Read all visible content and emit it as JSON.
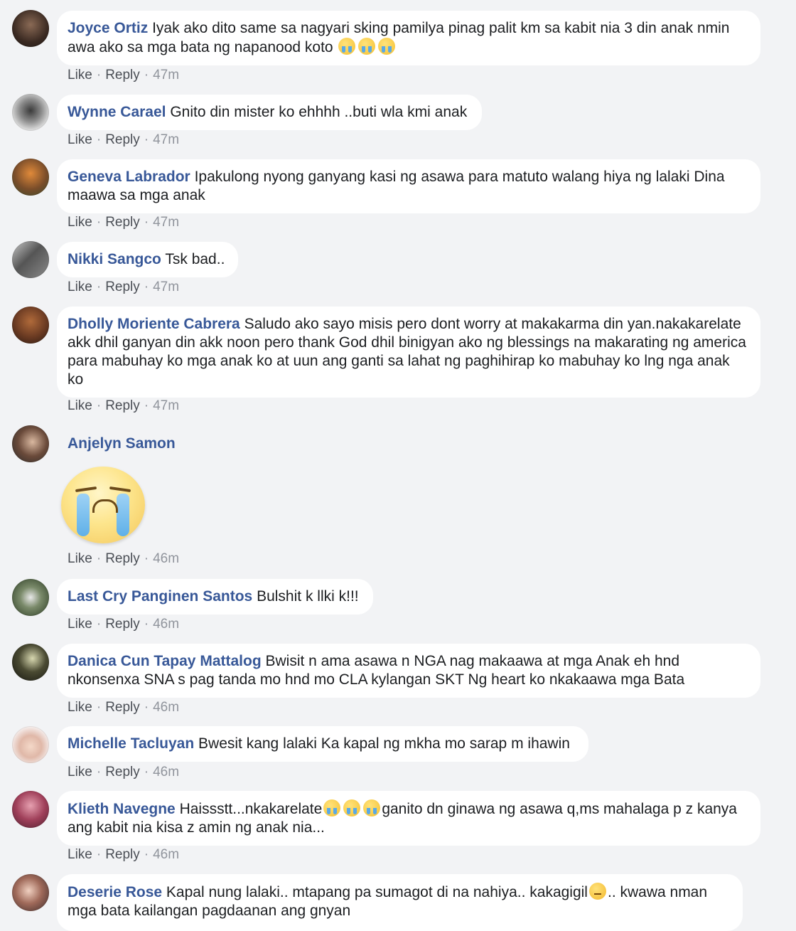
{
  "actions": {
    "like": "Like",
    "reply": "Reply",
    "dot": "·"
  },
  "comments": [
    {
      "author": "Joyce Ortiz",
      "text": "Iyak ako dito same sa nagyari sking pamilya pinag palit km sa kabit nia 3 din anak nmin awa ako sa mga bata ng napanood koto",
      "time": "47m",
      "emoji": "loudly-crying-face"
    },
    {
      "author": "Wynne Carael",
      "text": "Gnito din mister ko ehhhh ..buti wla kmi anak",
      "time": "47m"
    },
    {
      "author": "Geneva Labrador",
      "text": "Ipakulong nyong ganyang kasi ng asawa para matuto walang hiya ng lalaki Dina maawa sa mga anak",
      "time": "47m"
    },
    {
      "author": "Nikki Sangco",
      "text": "Tsk bad..",
      "time": "47m"
    },
    {
      "author": "Dholly Moriente Cabrera",
      "text": "Saludo ako sayo misis pero dont worry at makakarma din yan.nakakarelate akk dhil ganyan din akk noon pero thank God dhil binigyan ako ng blessings na makarating ng america para mabuhay ko mga anak ko at uun ang ganti sa lahat ng paghihirap ko mabuhay ko lng nga anak ko",
      "time": "47m"
    },
    {
      "author": "Anjelyn Samon",
      "text": "",
      "time": "46m",
      "sticker": "crying-face-sticker"
    },
    {
      "author": "Last Cry Panginen Santos",
      "text": "Bulshit k llki k!!!",
      "time": "46m"
    },
    {
      "author": "Danica Cun Tapay Mattalog",
      "text": "Bwisit n ama asawa n NGA nag makaawa at mga Anak eh hnd nkonsenxa SNA s pag tanda mo hnd mo CLA kylangan SKT Ng heart ko nkakaawa mga Bata",
      "time": "46m"
    },
    {
      "author": "Michelle Tacluyan",
      "text": "Bwesit kang lalaki Ka kapal ng mkha mo sarap m ihawin",
      "time": "46m"
    },
    {
      "author": "Klieth Navegne",
      "text_before": "Haissstt...nkakarelate",
      "text_after": "ganito dn ginawa ng asawa q,ms mahalaga p z kanya ang kabit nia kisa z amin ng anak nia...",
      "time": "46m",
      "emoji": "loudly-crying-face"
    },
    {
      "author": "Deserie Rose",
      "text_before": "Kapal nung lalaki.. mtapang pa sumagot di na nahiya.. kakagigil",
      "text_after": ".. kwawa nman mga bata kailangan pagdaanan ang gnyan",
      "emoji": "angry-face"
    }
  ],
  "colors": {
    "author": "#385898",
    "background": "#f2f3f5",
    "bubble": "#ffffff",
    "meta": "#90949c"
  }
}
